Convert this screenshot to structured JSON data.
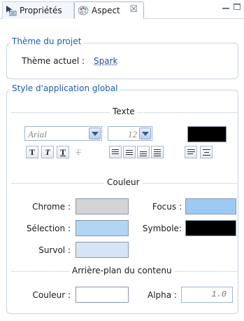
{
  "tabs": {
    "properties_label": "Propriétés",
    "aspect_label": "Aspect",
    "close_glyph": "☒"
  },
  "theme_group": {
    "legend": "Thème du projet",
    "current_label": "Thème actuel :",
    "current_value": "Spark"
  },
  "global_group": {
    "legend": "Style d'application global",
    "text_section": "Texte",
    "font_family": "Arial",
    "font_size": "12",
    "text_color": "#000000",
    "format_buttons": [
      "T",
      "T",
      "T",
      "T"
    ],
    "color_section": "Couleur",
    "chrome_label": "Chrome :",
    "chrome_color": "#d4d4d4",
    "focus_label": "Focus :",
    "focus_color": "#9dcaf5",
    "selection_label": "Sélection :",
    "selection_color": "#b3d4f5",
    "symbol_label": "Symbole:",
    "symbol_color": "#000000",
    "hover_label": "Survol :",
    "hover_color": "#d6e5f5",
    "bg_section": "Arrière-plan du contenu",
    "bg_color_label": "Couleur :",
    "bg_color": "#ffffff",
    "alpha_label": "Alpha :",
    "alpha_value": "1.0"
  }
}
